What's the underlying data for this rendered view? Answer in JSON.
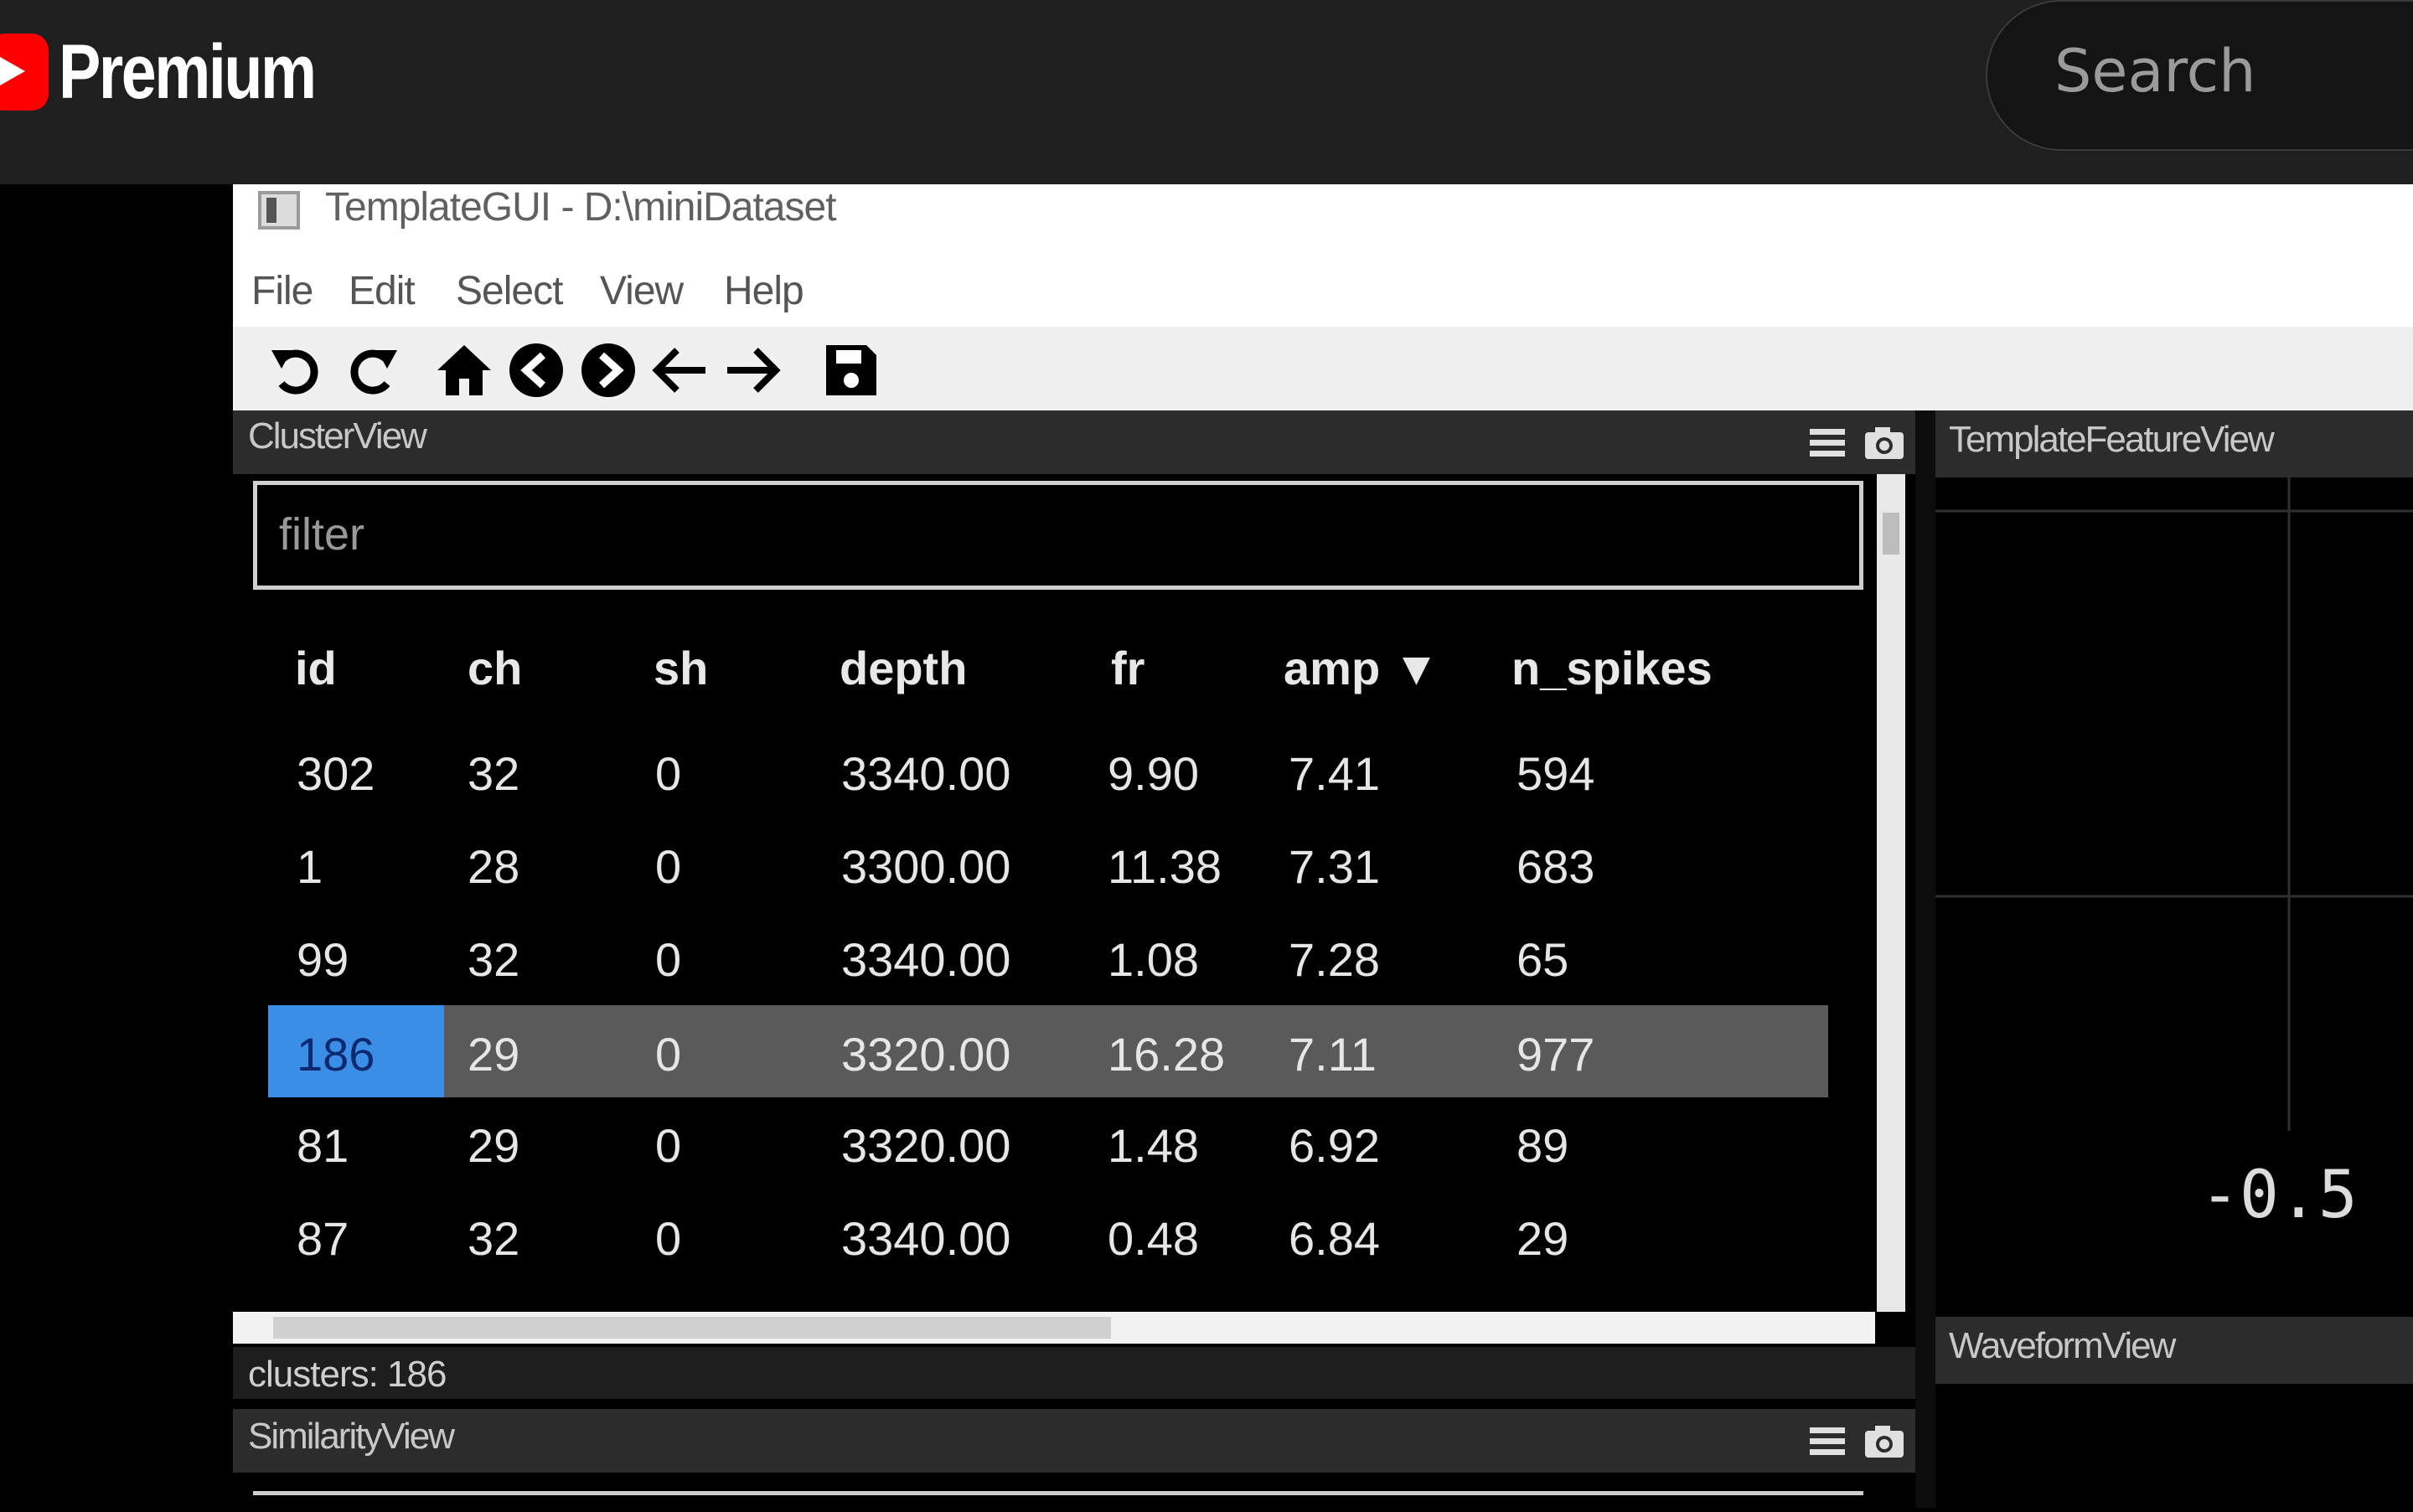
{
  "youtube": {
    "brand": "Premium",
    "search_placeholder": "Search"
  },
  "window": {
    "title": "TemplateGUI - D:\\miniDataset"
  },
  "menu": [
    "File",
    "Edit",
    "Select",
    "View",
    "Help"
  ],
  "toolbar": {
    "icons": [
      "undo-icon",
      "redo-icon",
      "home-icon",
      "circle-back-icon",
      "circle-forward-icon",
      "arrow-left-icon",
      "arrow-right-icon",
      "save-icon"
    ]
  },
  "cluster_view": {
    "title": "ClusterView",
    "filter_placeholder": "filter",
    "columns": [
      "id",
      "ch",
      "sh",
      "depth",
      "fr",
      "amp ▼",
      "n_spikes"
    ],
    "rows": [
      [
        "302",
        "32",
        "0",
        "3340.00",
        "9.90",
        "7.41",
        "594"
      ],
      [
        "1",
        "28",
        "0",
        "3300.00",
        "11.38",
        "7.31",
        "683"
      ],
      [
        "99",
        "32",
        "0",
        "3340.00",
        "1.08",
        "7.28",
        "65"
      ],
      [
        "186",
        "29",
        "0",
        "3320.00",
        "16.28",
        "7.11",
        "977"
      ],
      [
        "81",
        "29",
        "0",
        "3320.00",
        "1.48",
        "6.92",
        "89"
      ],
      [
        "87",
        "32",
        "0",
        "3340.00",
        "0.48",
        "6.84",
        "29"
      ]
    ],
    "selected_row": 3,
    "status": "clusters: 186"
  },
  "similarity_view": {
    "title": "SimilarityView"
  },
  "template_feature_view": {
    "title": "TemplateFeatureView",
    "axis_label": "-0.5"
  },
  "waveform_view": {
    "title": "WaveformView"
  },
  "colors": {
    "selection": "#3a8ee6",
    "selected_row": "#5a5a5a",
    "brand_red": "#ff0000"
  }
}
